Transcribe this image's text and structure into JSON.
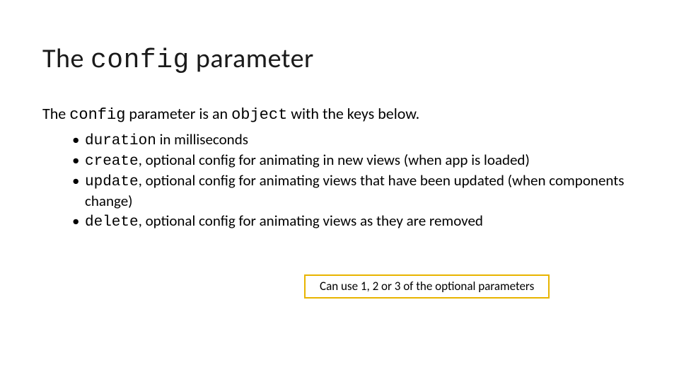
{
  "title": {
    "pre": "The ",
    "code": "config",
    "post": " parameter"
  },
  "intro": {
    "pre": "The ",
    "code1": "config",
    "mid": " parameter is an ",
    "code2": "object",
    "post": " with the keys below."
  },
  "bullets": [
    {
      "code": "duration",
      "text": " in milliseconds"
    },
    {
      "code": "create",
      "text": ", optional config for animating in new views (when app is loaded)"
    },
    {
      "code": "update",
      "text": ", optional config for animating views that have been updated (when components change)"
    },
    {
      "code": "delete",
      "text": ", optional config for animating views as they are removed"
    }
  ],
  "callout": "Can use 1, 2 or 3 of the optional parameters"
}
